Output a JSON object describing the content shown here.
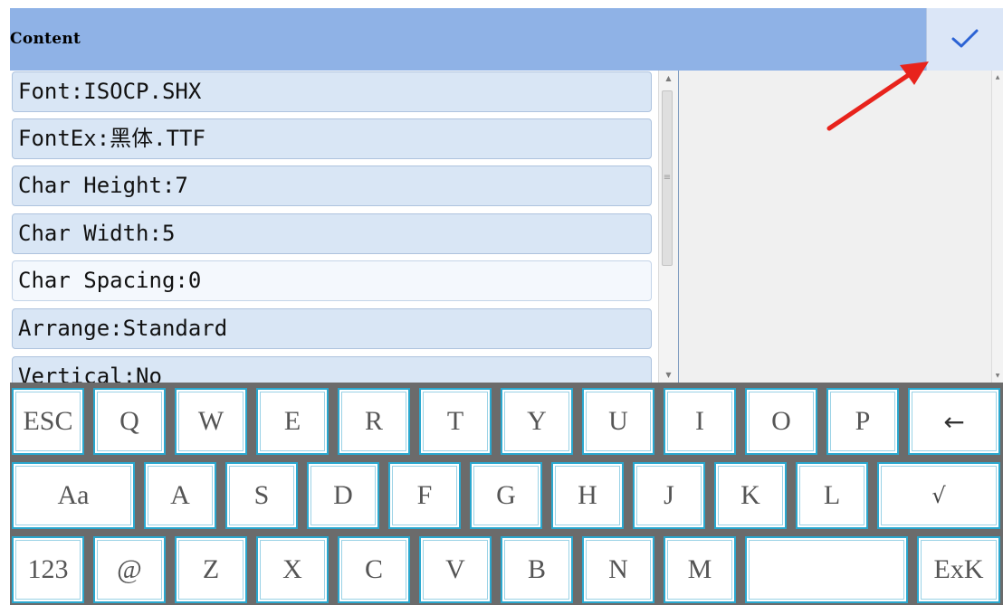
{
  "header": {
    "title": "Content",
    "confirm_icon": "checkmark-icon"
  },
  "list": {
    "items": [
      {
        "label": "Font:ISOCP.SHX"
      },
      {
        "label": "FontEx:黑体.TTF"
      },
      {
        "label": "Char Height:7"
      },
      {
        "label": "Char Width:5"
      },
      {
        "label": "Char Spacing:0",
        "selected": true
      },
      {
        "label": "Arrange:Standard"
      },
      {
        "label": "Vertical:No"
      }
    ]
  },
  "keyboard": {
    "rows": [
      [
        "ESC",
        "Q",
        "W",
        "E",
        "R",
        "T",
        "Y",
        "U",
        "I",
        "O",
        "P",
        "←"
      ],
      [
        "Aa",
        "A",
        "S",
        "D",
        "F",
        "G",
        "H",
        "J",
        "K",
        "L",
        "√"
      ],
      [
        "123",
        "@",
        "Z",
        "X",
        "C",
        "V",
        "B",
        "N",
        "M",
        "",
        "ExK"
      ]
    ]
  },
  "colors": {
    "header": "#8fb2e6",
    "row": "#d9e6f5",
    "key_border": "#2aa8cf",
    "annotation": "#e8231c"
  }
}
